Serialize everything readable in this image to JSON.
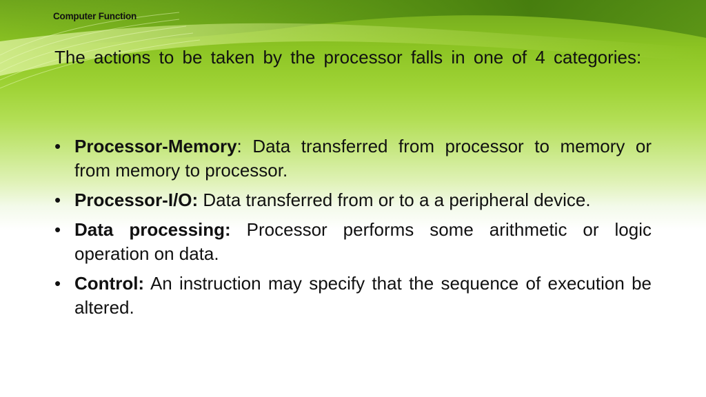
{
  "slide": {
    "header_title": "Computer Function",
    "intro": "The actions to be taken by the processor falls in one of 4 categories:",
    "bullet_glyph": "•",
    "bullets": [
      {
        "term": "Processor-Memory",
        "separator": ": ",
        "text": "Data transferred from processor to memory or from memory to processor."
      },
      {
        "term": "Processor-I/O:",
        "separator": " ",
        "text": "Data transferred from or to a a peripheral device."
      },
      {
        "term": "Data processing:",
        "separator": " ",
        "text": "Processor performs some arithmetic or logic operation on data."
      },
      {
        "term": "Control:",
        "separator": " ",
        "text": "An instruction may specify that the sequence of execution be altered."
      }
    ],
    "colors": {
      "theme_green_dark": "#4e8a12",
      "theme_green": "#8cc423",
      "theme_green_light": "#c8e884",
      "text": "#111111"
    }
  }
}
